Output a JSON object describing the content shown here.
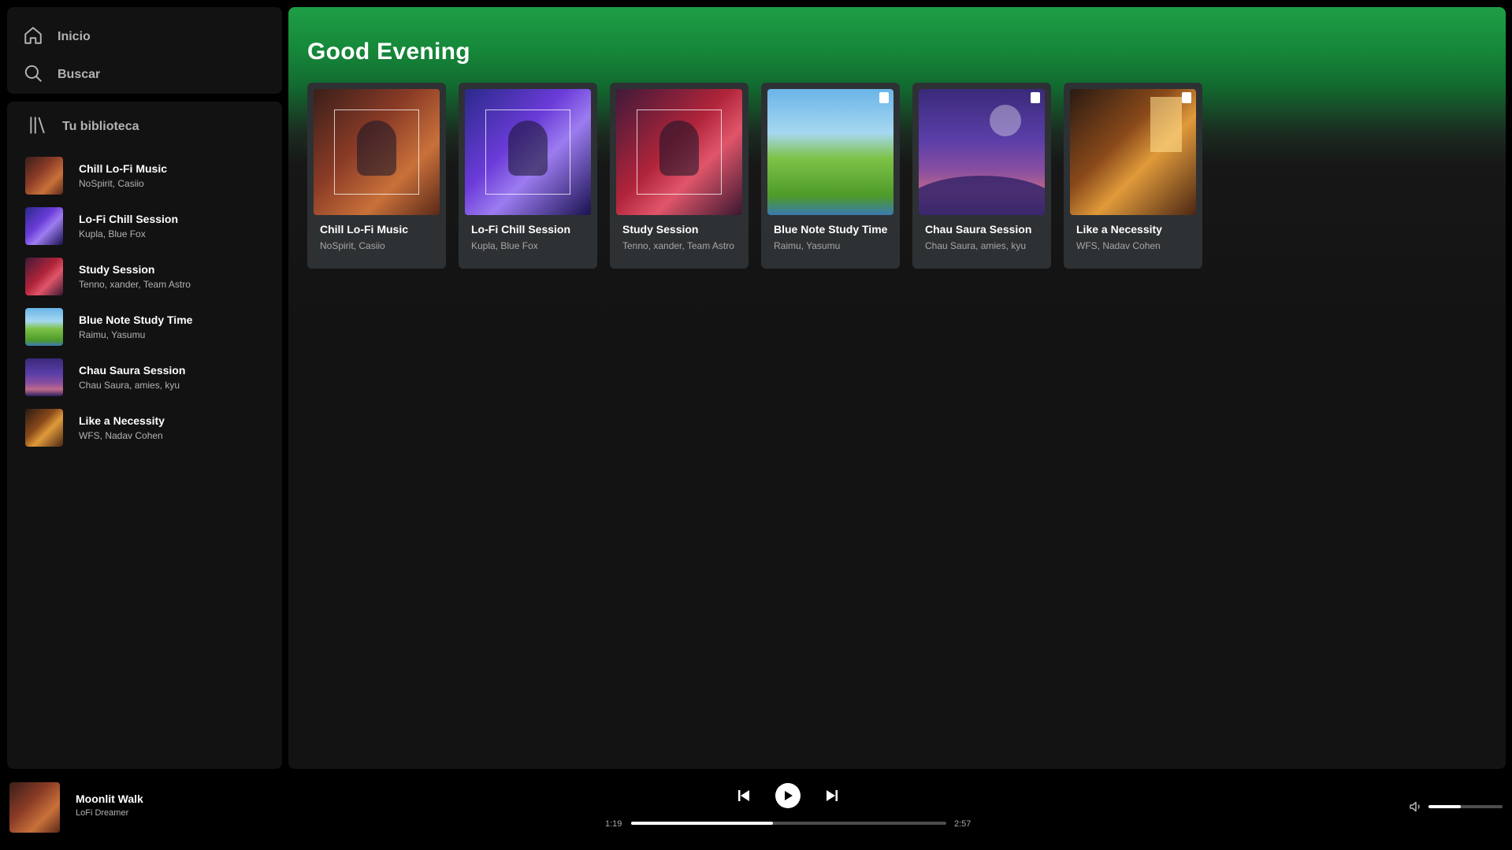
{
  "nav": {
    "home_label": "Inicio",
    "search_label": "Buscar"
  },
  "library": {
    "title": "Tu biblioteca",
    "items": [
      {
        "name": "Chill Lo-Fi Music",
        "artists": "NoSpirit, Casiio"
      },
      {
        "name": "Lo-Fi Chill Session",
        "artists": "Kupla, Blue Fox"
      },
      {
        "name": "Study Session",
        "artists": "Tenno, xander, Team Astro"
      },
      {
        "name": "Blue Note Study Time",
        "artists": "Raimu, Yasumu"
      },
      {
        "name": "Chau Saura Session",
        "artists": "Chau Saura, amies, kyu"
      },
      {
        "name": "Like a Necessity",
        "artists": "WFS, Nadav Cohen"
      }
    ]
  },
  "main": {
    "title": "Good Evening",
    "cards": [
      {
        "name": "Chill Lo-Fi Music",
        "artists": "NoSpirit, Casiio"
      },
      {
        "name": "Lo-Fi Chill Session",
        "artists": "Kupla, Blue Fox"
      },
      {
        "name": "Study Session",
        "artists": "Tenno, xander, Team Astro"
      },
      {
        "name": "Blue Note Study Time",
        "artists": "Raimu, Yasumu"
      },
      {
        "name": "Chau Saura Session",
        "artists": "Chau Saura, amies, kyu"
      },
      {
        "name": "Like a Necessity",
        "artists": "WFS, Nadav Cohen"
      }
    ]
  },
  "player": {
    "track_title": "Moonlit Walk",
    "track_artist": "LoFi Dreamer",
    "current_time": "1:19",
    "duration": "2:57",
    "progress_fraction": 0.45,
    "volume_fraction": 0.44
  },
  "colors": {
    "accent": "#1db954",
    "panel": "#121212",
    "card": "#2d3133"
  }
}
